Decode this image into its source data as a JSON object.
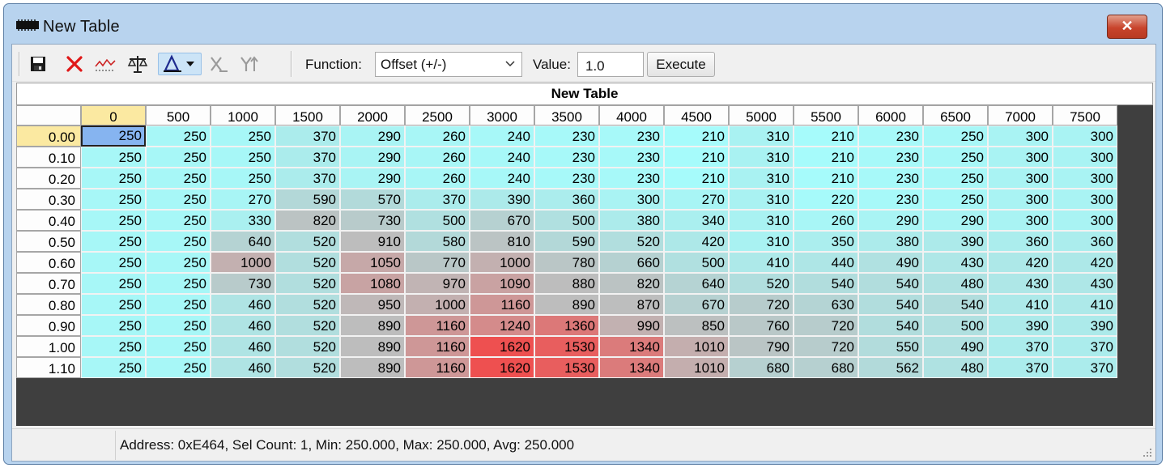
{
  "window": {
    "title": "New Table",
    "close_glyph": "✕"
  },
  "toolbar": {
    "buttons": [
      {
        "name": "save-icon"
      },
      {
        "name": "delete-icon"
      },
      {
        "name": "graph-icon"
      },
      {
        "name": "compare-icon"
      },
      {
        "name": "interpolate-icon"
      },
      {
        "name": "disabled-tool-icon"
      },
      {
        "name": "disabled-tool-icon"
      }
    ],
    "function_label": "Function:",
    "function_value": "Offset (+/-)",
    "value_label": "Value:",
    "value": "1.0",
    "execute_label": "Execute"
  },
  "table": {
    "title": "New Table",
    "columns": [
      "0",
      "500",
      "1000",
      "1500",
      "2000",
      "2500",
      "3000",
      "3500",
      "4000",
      "4500",
      "5000",
      "5500",
      "6000",
      "6500",
      "7000",
      "7500"
    ],
    "rows": [
      "0.00",
      "0.10",
      "0.20",
      "0.30",
      "0.40",
      "0.50",
      "0.60",
      "0.70",
      "0.80",
      "0.90",
      "1.00",
      "1.10"
    ],
    "values": [
      [
        250,
        250,
        250,
        370,
        290,
        260,
        240,
        230,
        230,
        210,
        310,
        210,
        230,
        250,
        300,
        300
      ],
      [
        250,
        250,
        250,
        370,
        290,
        260,
        240,
        230,
        230,
        210,
        310,
        210,
        230,
        250,
        300,
        300
      ],
      [
        250,
        250,
        250,
        370,
        290,
        260,
        240,
        230,
        230,
        210,
        310,
        210,
        230,
        250,
        300,
        300
      ],
      [
        250,
        250,
        270,
        590,
        570,
        370,
        390,
        360,
        300,
        270,
        310,
        220,
        230,
        250,
        300,
        300
      ],
      [
        250,
        250,
        330,
        820,
        730,
        500,
        670,
        500,
        380,
        340,
        310,
        260,
        290,
        290,
        300,
        300
      ],
      [
        250,
        250,
        640,
        520,
        910,
        580,
        810,
        590,
        520,
        420,
        310,
        350,
        380,
        390,
        360,
        360
      ],
      [
        250,
        250,
        1000,
        520,
        1050,
        770,
        1000,
        780,
        660,
        500,
        410,
        440,
        490,
        430,
        420,
        420
      ],
      [
        250,
        250,
        730,
        520,
        1080,
        970,
        1090,
        880,
        820,
        640,
        520,
        540,
        540,
        480,
        430,
        430
      ],
      [
        250,
        250,
        460,
        520,
        950,
        1000,
        1160,
        890,
        870,
        670,
        720,
        630,
        540,
        540,
        410,
        410
      ],
      [
        250,
        250,
        460,
        520,
        890,
        1160,
        1240,
        1360,
        990,
        850,
        760,
        720,
        540,
        500,
        390,
        390
      ],
      [
        250,
        250,
        460,
        520,
        890,
        1160,
        1620,
        1530,
        1340,
        1010,
        790,
        720,
        550,
        490,
        370,
        370
      ],
      [
        250,
        250,
        460,
        520,
        890,
        1160,
        1620,
        1530,
        1340,
        1010,
        680,
        680,
        562,
        480,
        370,
        370
      ]
    ],
    "selected_row": 0,
    "selected_col": 0
  },
  "colors": {
    "low": "#a6fbfb",
    "mid": "#bdbdbd",
    "high": "#ee5050",
    "selected": "#86b4f0",
    "header_selected": "#fbe9a1"
  },
  "status": {
    "text": "Address: 0xE464, Sel Count: 1, Min: 250.000, Max: 250.000, Avg: 250.000"
  }
}
